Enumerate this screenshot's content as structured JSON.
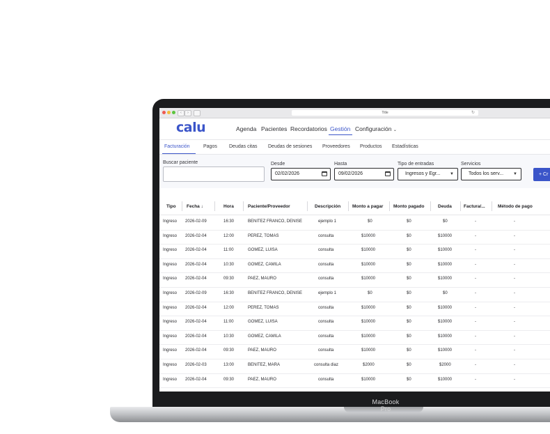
{
  "device_label": "MacBook Pro",
  "browser": {
    "title": "Title"
  },
  "app": {
    "logo": "calu",
    "nav": [
      "Agenda",
      "Pacientes",
      "Recordatorios",
      "Gestión",
      "Configuración"
    ],
    "active_nav": "Gestión",
    "subtabs": [
      "Facturación",
      "Pagos",
      "Deudas citas",
      "Deudas de sesiones",
      "Proveedores",
      "Productos",
      "Estadísticas"
    ],
    "active_subtab": "Facturación"
  },
  "filters": {
    "search_label": "Buscar paciente",
    "search_value": "",
    "from_label": "Desde",
    "from_value": "02/02/2026",
    "to_label": "Hasta",
    "to_value": "09/02/2026",
    "entry_type_label": "Tipo de entradas",
    "entry_type_value": "Ingresos y Egr...",
    "services_label": "Servicios",
    "services_value": "Todos los serv...",
    "create_button": "+ Cr"
  },
  "table": {
    "columns": [
      "Tipo",
      "Fecha",
      "Hora",
      "Paciente/Proveedor",
      "Descripción",
      "Monto a pagar",
      "Monto pagado",
      "Deuda",
      "Factura/...",
      "Método de pago"
    ],
    "sort_indicator": "↓",
    "rows": [
      [
        "Ingreso",
        "2026-02-09",
        "16:30",
        "BENITEZ FRANCO, DENISE",
        "ejemplo 1",
        "$0",
        "$0",
        "$0",
        "-",
        "-"
      ],
      [
        "Ingreso",
        "2026-02-04",
        "12:00",
        "PEREZ, TOMAS",
        "consulta",
        "$10000",
        "$0",
        "$10000",
        "-",
        "-"
      ],
      [
        "Ingreso",
        "2026-02-04",
        "11:00",
        "GOMEZ, LUISA",
        "consulta",
        "$10000",
        "$0",
        "$10000",
        "-",
        "-"
      ],
      [
        "Ingreso",
        "2026-02-04",
        "10:30",
        "GOMEZ, CAMILA",
        "consulta",
        "$10000",
        "$0",
        "$10000",
        "-",
        "-"
      ],
      [
        "Ingreso",
        "2026-02-04",
        "09:30",
        "PAEZ, MAURO",
        "consulta",
        "$10000",
        "$0",
        "$10000",
        "-",
        "-"
      ],
      [
        "Ingreso",
        "2026-02-09",
        "16:30",
        "BENITEZ FRANCO, DENISE",
        "ejemplo 1",
        "$0",
        "$0",
        "$0",
        "-",
        "-"
      ],
      [
        "Ingreso",
        "2026-02-04",
        "12:00",
        "PEREZ, TOMAS",
        "consulta",
        "$10000",
        "$0",
        "$10000",
        "-",
        "-"
      ],
      [
        "Ingreso",
        "2026-02-04",
        "11:00",
        "GOMEZ, LUISA",
        "consulta",
        "$10000",
        "$0",
        "$10000",
        "-",
        "-"
      ],
      [
        "Ingreso",
        "2026-02-04",
        "10:30",
        "GOMEZ, CAMILA",
        "consulta",
        "$10000",
        "$0",
        "$10000",
        "-",
        "-"
      ],
      [
        "Ingreso",
        "2026-02-04",
        "09:30",
        "PAEZ, MAURO",
        "consulta",
        "$10000",
        "$0",
        "$10000",
        "-",
        "-"
      ],
      [
        "Ingreso",
        "2026-02-03",
        "13:00",
        "BENITEZ, MARA",
        "consulta diaz",
        "$2000",
        "$0",
        "$2000",
        "-",
        "-"
      ],
      [
        "Ingreso",
        "2026-02-04",
        "09:30",
        "PAEZ, MAURO",
        "consulta",
        "$10000",
        "$0",
        "$10000",
        "-",
        "-"
      ]
    ]
  },
  "colors": {
    "accent": "#3b55c9",
    "frame": "#1b1c1e"
  }
}
